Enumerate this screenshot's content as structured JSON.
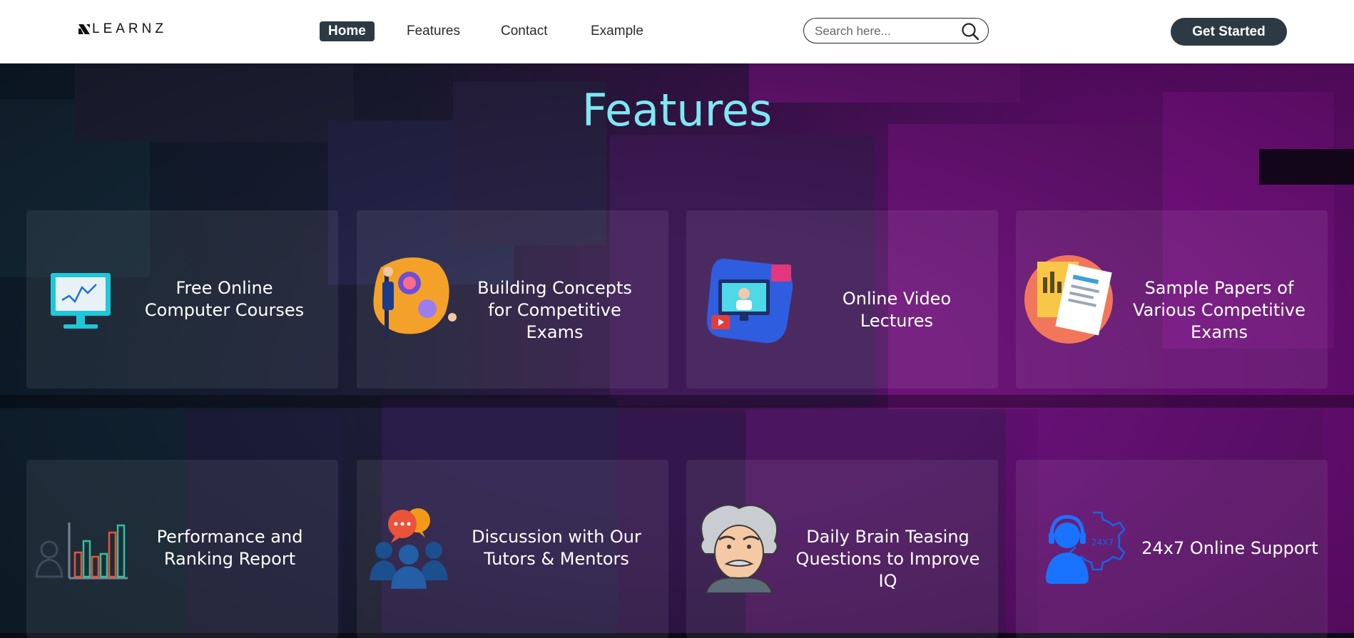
{
  "header": {
    "logo_text": "LEARNZ",
    "nav": [
      "Home",
      "Features",
      "Contact",
      "Example"
    ],
    "search_placeholder": "Search here...",
    "cta_label": "Get Started"
  },
  "main": {
    "title": "Features",
    "features": [
      {
        "label": "Free Online Computer Courses",
        "icon": "computer-monitor-icon"
      },
      {
        "label": "Building Concepts for Competitive Exams",
        "icon": "concept-brain-icon"
      },
      {
        "label": "Online Video Lectures",
        "icon": "video-lecture-icon"
      },
      {
        "label": "Sample Papers of Various Competitive Exams",
        "icon": "sample-papers-icon"
      },
      {
        "label": "Performance and Ranking Report",
        "icon": "ranking-chart-icon"
      },
      {
        "label": "Discussion with Our Tutors & Mentors",
        "icon": "discussion-group-icon"
      },
      {
        "label": "Daily Brain Teasing Questions to Improve IQ",
        "icon": "einstein-icon"
      },
      {
        "label": "24x7 Online Support",
        "icon": "support-headset-icon"
      }
    ]
  },
  "colors": {
    "accent_title": "#7de8f2",
    "button_dark": "#2d3a44",
    "bg_purple": "#760f84",
    "bg_navy": "#0f2030"
  }
}
